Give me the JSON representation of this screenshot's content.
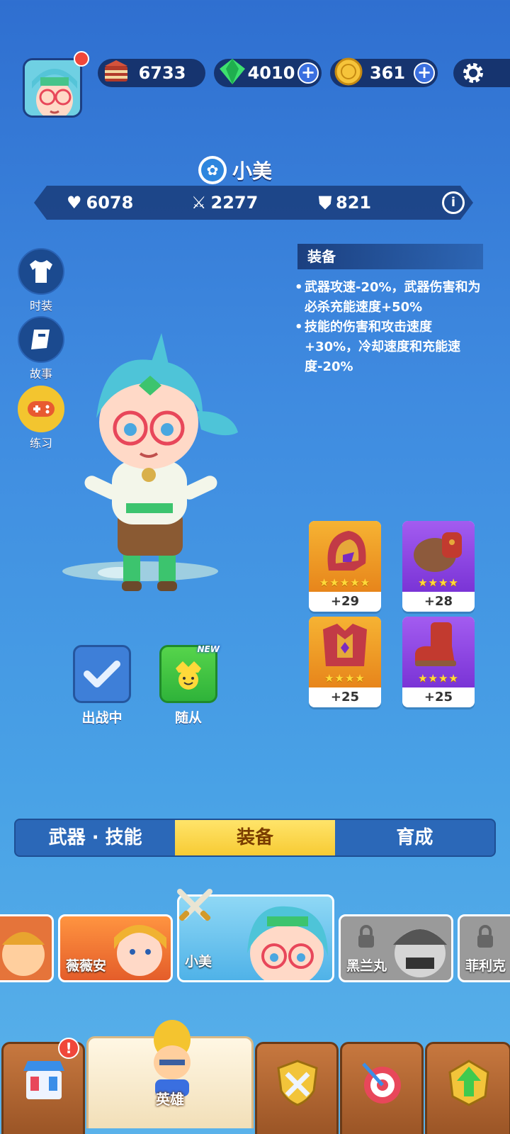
{
  "resources": {
    "cake": "6733",
    "gems": "4010",
    "coins": "361"
  },
  "hero": {
    "name": "小美",
    "stats": {
      "health": "6078",
      "attack": "2277",
      "defense": "821"
    }
  },
  "side_menu": [
    {
      "label": "时装",
      "icon": "shirt-icon"
    },
    {
      "label": "故事",
      "icon": "book-icon"
    },
    {
      "label": "练习",
      "icon": "gamepad-icon"
    }
  ],
  "equipment_desc": {
    "title": "装备",
    "lines": [
      "武器攻速-20%，武器伤害和为必杀充能速度+50%",
      "技能的伤害和攻击速度+30%，冷却速度和充能速度-20%"
    ]
  },
  "equipment": [
    {
      "level": "+29",
      "rarity": "gold",
      "stars": "★★★★★",
      "icon": "helmet-icon"
    },
    {
      "level": "+28",
      "rarity": "purple",
      "stars": "★★★★",
      "icon": "glove-icon"
    },
    {
      "level": "+25",
      "rarity": "gold",
      "stars": "★★★★",
      "icon": "armor-icon"
    },
    {
      "level": "+25",
      "rarity": "purple",
      "stars": "★★★★",
      "icon": "boot-icon"
    }
  ],
  "actions": {
    "deploy_label": "出战中",
    "follower_label": "随从",
    "new_tag": "NEW"
  },
  "tabs": [
    "武器 · 技能",
    "装备",
    "育成"
  ],
  "active_tab": "装备",
  "heroes": [
    {
      "name": ""
    },
    {
      "name": "薇薇安"
    },
    {
      "name": "小美"
    },
    {
      "name": "黑兰丸"
    },
    {
      "name": "菲利克"
    }
  ],
  "bottom_nav": {
    "active_label": "英雄"
  },
  "colors": {
    "bg_top": "#2f6fd0",
    "bg_bottom": "#5ab2ea",
    "panel": "#16346f",
    "accent_yellow": "#f7cb34",
    "alert_red": "#f0473a"
  }
}
